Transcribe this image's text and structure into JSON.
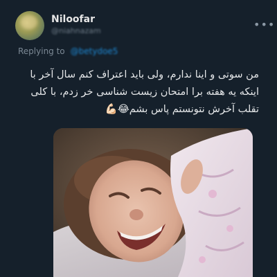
{
  "author": {
    "display_name": "Niloofar",
    "handle": "@niahnazam"
  },
  "reply": {
    "label": "Replying to",
    "mention": "@betydoe5"
  },
  "tweet": {
    "lines": [
      "من سوتی و اینا ندارم، ولی باید اعتراف کنم سال آخر با",
      "اینکه یه هفته برا امتحان زیست شناسی خر زدم، با کلی",
      "تقلب آخرش نتونستم پاس بشم😂💪🏻"
    ]
  },
  "icons": {
    "more": "more-horizontal-icon"
  },
  "colors": {
    "background": "#15202b",
    "mention": "#1d8ad6"
  }
}
